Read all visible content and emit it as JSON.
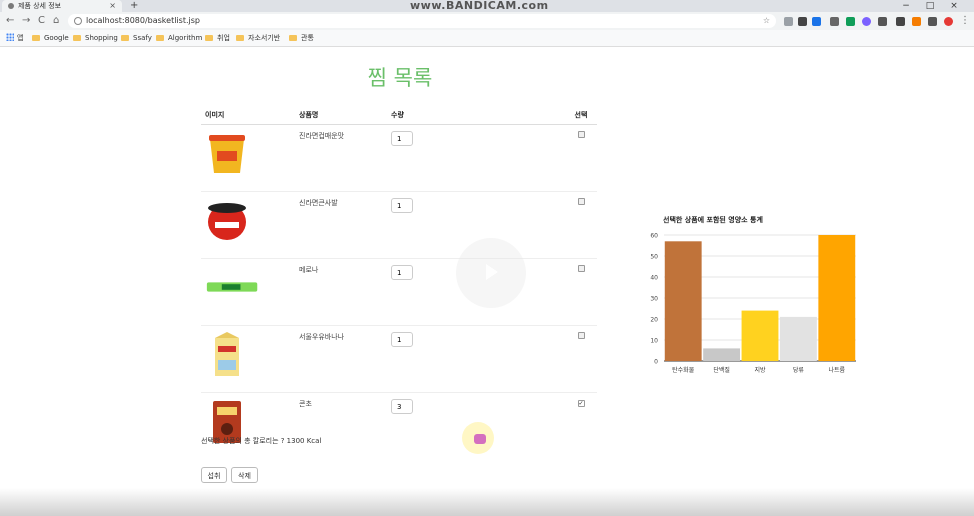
{
  "browser": {
    "tab_title": "제품 상세 정보",
    "tab_close": "×",
    "new_tab": "+",
    "watermark": "www.BANDICAM.com",
    "url": "localhost:8080/basketlist.jsp",
    "window_controls": [
      "−",
      "□",
      "×"
    ],
    "nav": {
      "back": "←",
      "forward": "→",
      "reload": "C",
      "home": "⌂"
    },
    "star": "☆",
    "bookmarks": [
      {
        "label": "앱",
        "icon": "apps-icon"
      },
      {
        "label": "Google",
        "icon": "folder-icon"
      },
      {
        "label": "Shopping",
        "icon": "folder-icon"
      },
      {
        "label": "Ssafy",
        "icon": "folder-icon"
      },
      {
        "label": "Algorithm",
        "icon": "folder-icon"
      },
      {
        "label": "취업",
        "icon": "folder-icon"
      },
      {
        "label": "자소서기반",
        "icon": "folder-icon"
      },
      {
        "label": "관통",
        "icon": "folder-icon"
      }
    ]
  },
  "page": {
    "title": "찜 목록",
    "columns": [
      "이미지",
      "상품명",
      "수량",
      "선택"
    ],
    "items": [
      {
        "name": "진라면컵매운맛",
        "qty": "1",
        "selected": false,
        "image": "ramen-cup-icon",
        "color": "#f2b620"
      },
      {
        "name": "신라면큰사발",
        "qty": "1",
        "selected": false,
        "image": "ramen-bowl-icon",
        "color": "#d8261c"
      },
      {
        "name": "메로나",
        "qty": "1",
        "selected": false,
        "image": "icecream-bar-icon",
        "color": "#7ed957"
      },
      {
        "name": "서울우유바나나",
        "qty": "1",
        "selected": false,
        "image": "milk-carton-icon",
        "color": "#f5e08a"
      },
      {
        "name": "콘초",
        "qty": "3",
        "selected": true,
        "image": "snack-box-icon",
        "color": "#b33a1e"
      }
    ],
    "calorie_text": "선택한 상품의 총 칼로리는 ? 1300 Kcal",
    "buttons": {
      "intake": "섭취",
      "delete": "삭제"
    },
    "check_mark": "✓"
  },
  "chart_data": {
    "type": "bar",
    "title": "선택한 상품에 포함된 영양소 통계",
    "categories": [
      "탄수화물",
      "단백질",
      "지방",
      "당류",
      "나트륨"
    ],
    "values": [
      57,
      6,
      24,
      21,
      60
    ],
    "colors": [
      "#c0733a",
      "#c8c8c8",
      "#ffd21f",
      "#e2e2e2",
      "#ffa500"
    ],
    "ylim": [
      0,
      60
    ],
    "yticks": [
      0,
      10,
      20,
      30,
      40,
      50,
      60
    ],
    "grid": true,
    "xlabel": "",
    "ylabel": ""
  }
}
